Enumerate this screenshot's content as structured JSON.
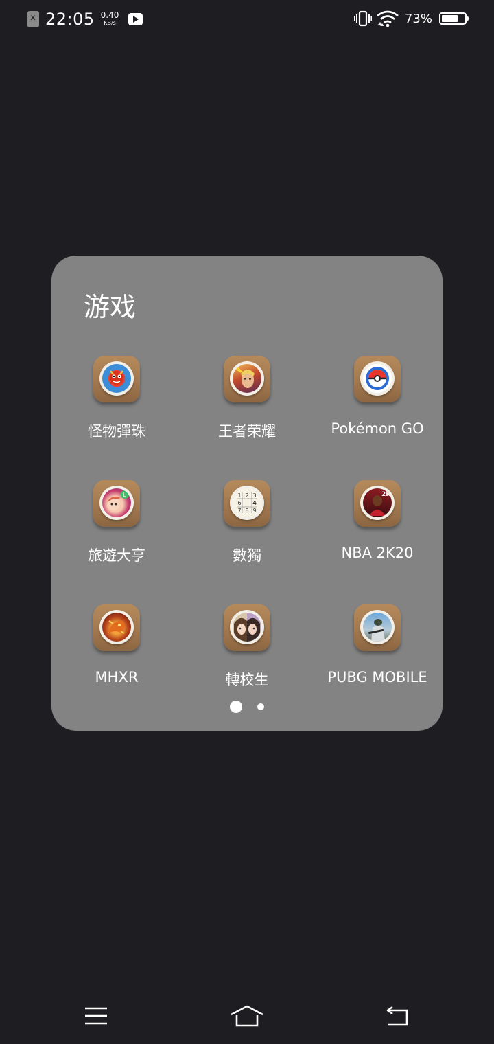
{
  "status_bar": {
    "time": "22:05",
    "net_speed_value": "0.40",
    "net_speed_unit": "KB/s",
    "battery_percent": "73%",
    "battery_level": 0.73
  },
  "folder": {
    "title": "游戏",
    "apps": [
      {
        "label": "怪物彈珠",
        "icon": "monster-strike-icon"
      },
      {
        "label": "王者荣耀",
        "icon": "honor-of-kings-icon"
      },
      {
        "label": "Pokémon GO",
        "icon": "pokeball-icon"
      },
      {
        "label": "旅遊大亨",
        "icon": "travel-tycoon-icon"
      },
      {
        "label": "數獨",
        "icon": "sudoku-icon"
      },
      {
        "label": "NBA 2K20",
        "icon": "nba-2k20-icon"
      },
      {
        "label": "MHXR",
        "icon": "mhxr-icon"
      },
      {
        "label": "轉校生",
        "icon": "transfer-student-icon"
      },
      {
        "label": "PUBG MOBILE",
        "icon": "pubg-mobile-icon"
      }
    ],
    "page_count": 2,
    "current_page": 1
  },
  "nav_bar": {
    "menu": "menu-icon",
    "home": "home-icon",
    "back": "back-icon"
  }
}
